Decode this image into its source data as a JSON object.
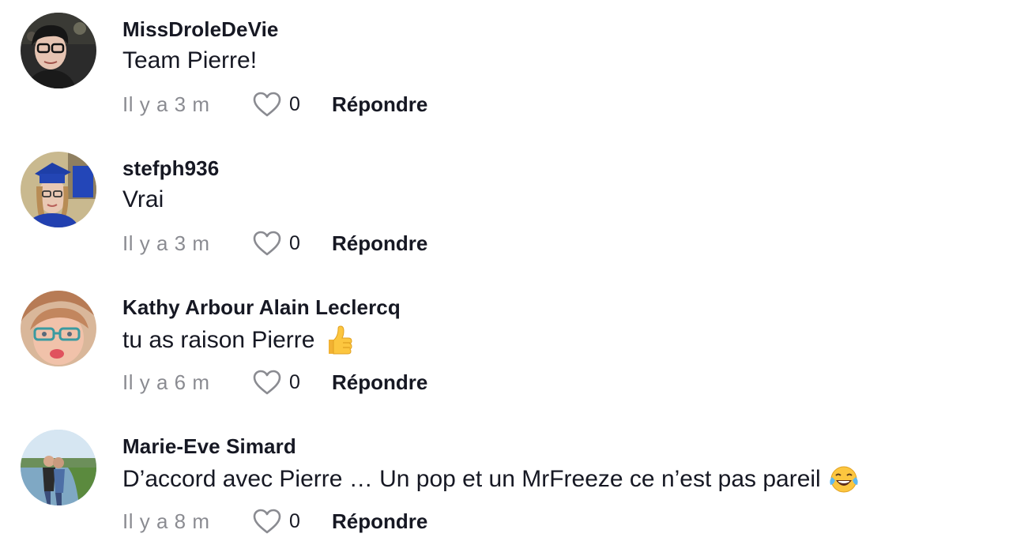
{
  "comments": [
    {
      "username": "MissDroleDeVie",
      "text": "Team Pierre!",
      "emoji": "",
      "time": "Il y a 3 m",
      "likes": "0",
      "reply_label": "Répondre"
    },
    {
      "username": "stefph936",
      "text": "Vrai",
      "emoji": "",
      "time": "Il y a 3 m",
      "likes": "0",
      "reply_label": "Répondre"
    },
    {
      "username": "Kathy Arbour Alain Leclercq",
      "text": "tu as raison Pierre",
      "emoji": "thumbs-up",
      "time": "Il y a 6 m",
      "likes": "0",
      "reply_label": "Répondre"
    },
    {
      "username": "Marie-Eve Simard",
      "text": "D’accord avec Pierre … Un pop et un MrFreeze ce n’est pas pareil",
      "emoji": "tears-of-joy",
      "time": "Il y a 8 m",
      "likes": "0",
      "reply_label": "Répondre"
    }
  ],
  "icons": {
    "like": "heart-outline-icon"
  },
  "colors": {
    "text": "#161823",
    "muted": "#8a8b91"
  }
}
